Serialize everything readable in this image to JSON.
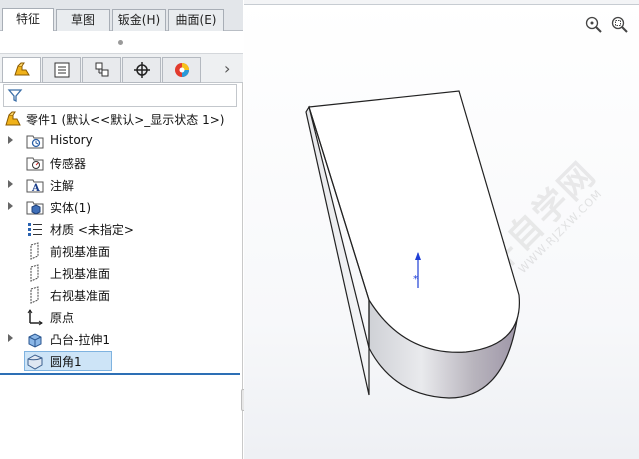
{
  "command_tabs": [
    {
      "label": "特征",
      "active": true
    },
    {
      "label": "草图",
      "active": false
    },
    {
      "label": "钣金(H)",
      "active": false
    },
    {
      "label": "曲面(E)",
      "active": false
    }
  ],
  "manager_tabs": [
    {
      "icon": "featuremanager-icon",
      "active": true
    },
    {
      "icon": "propertymanager-icon",
      "active": false
    },
    {
      "icon": "configurationmanager-icon",
      "active": false
    },
    {
      "icon": "dimxpert-icon",
      "active": false
    },
    {
      "icon": "display-manager-icon",
      "active": false
    }
  ],
  "filter_icon": "funnel-icon",
  "tree": {
    "root": "零件1 (默认<<默认>_显示状态 1>)",
    "items": [
      {
        "label": "History",
        "icon": "history-icon",
        "expandable": true
      },
      {
        "label": "传感器",
        "icon": "sensor-icon",
        "expandable": false
      },
      {
        "label": "注解",
        "icon": "annotation-icon",
        "expandable": true
      },
      {
        "label": "实体(1)",
        "icon": "solid-bodies-icon",
        "expandable": true
      },
      {
        "label": "材质 <未指定>",
        "icon": "material-icon",
        "expandable": false
      },
      {
        "label": "前视基准面",
        "icon": "plane-icon",
        "expandable": false
      },
      {
        "label": "上视基准面",
        "icon": "plane-icon",
        "expandable": false
      },
      {
        "label": "右视基准面",
        "icon": "plane-icon",
        "expandable": false
      },
      {
        "label": "原点",
        "icon": "origin-icon",
        "expandable": false
      },
      {
        "label": "凸台-拉伸1",
        "icon": "extrude-icon",
        "expandable": true
      },
      {
        "label": "圆角1",
        "icon": "fillet-icon",
        "expandable": false,
        "selected": true
      }
    ]
  },
  "viewport": {
    "watermark": "软件自学网",
    "watermark_url": "WWW.RJZXW.COM"
  },
  "colors": {
    "selection": "#cde4f7",
    "accent_line": "#2d6fb5",
    "axis_blue": "#1f3fd6"
  }
}
